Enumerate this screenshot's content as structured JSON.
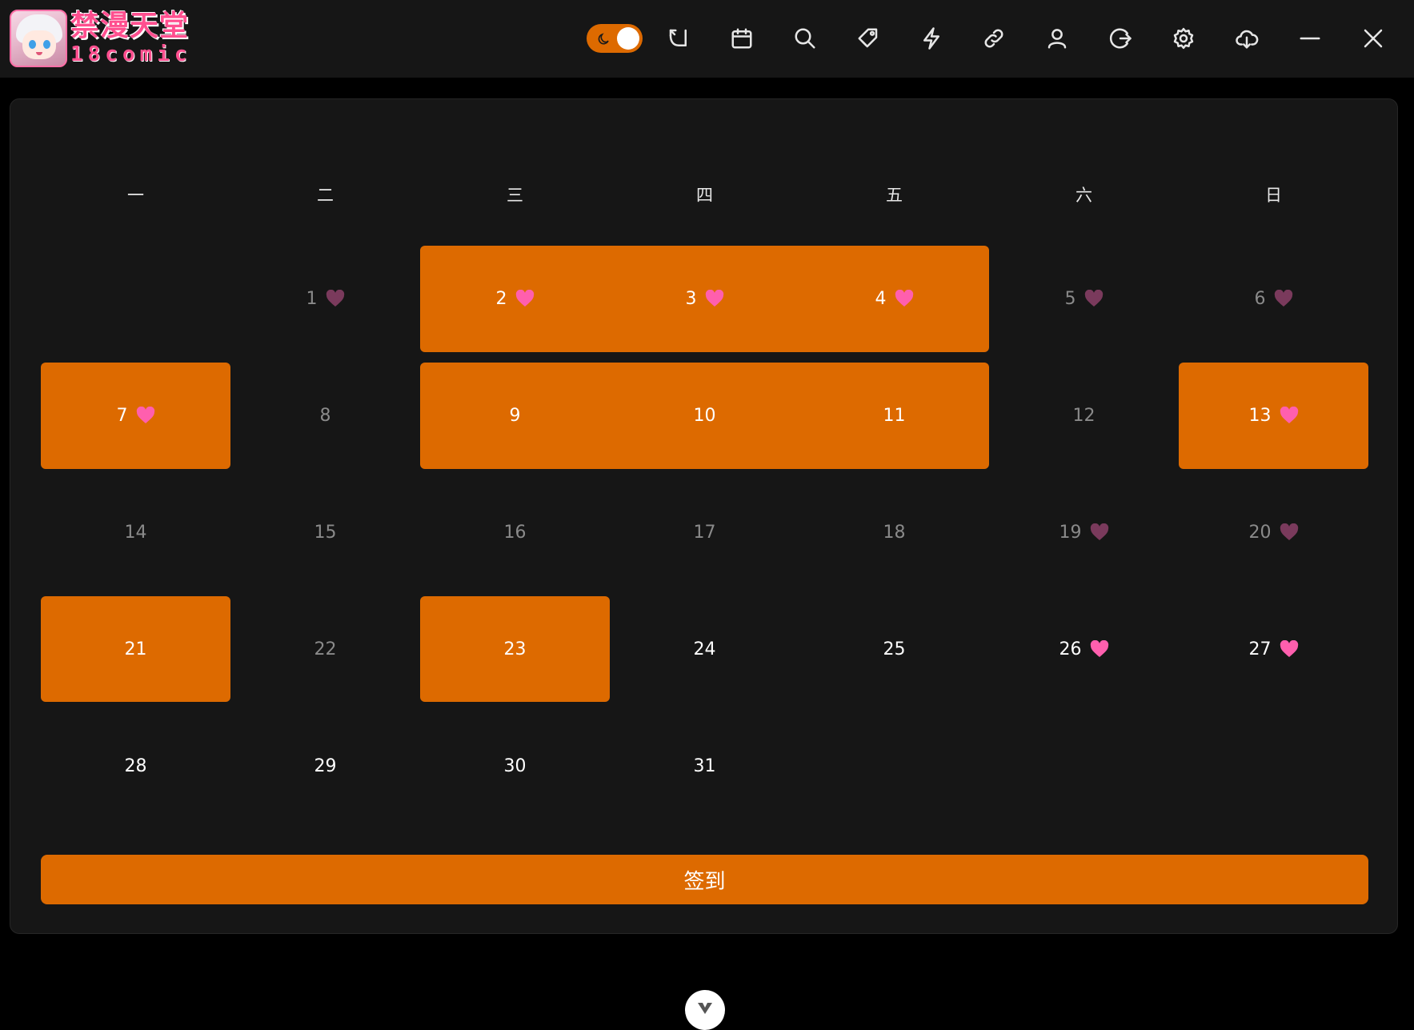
{
  "app": {
    "logo_cn": "禁漫天堂",
    "logo_en": "18comic"
  },
  "toolbar": {
    "icons": [
      "moon-icon",
      "back-icon",
      "calendar-icon",
      "search-icon",
      "tag-icon",
      "lightning-icon",
      "link-icon",
      "user-icon",
      "logout-icon",
      "gear-icon",
      "cloud-download-icon",
      "minimize-icon",
      "close-icon"
    ],
    "dark_mode": true
  },
  "calendar": {
    "weekdays": [
      "一",
      "二",
      "三",
      "四",
      "五",
      "六",
      "日"
    ],
    "days": [
      {
        "day": "1"
      },
      {
        "day": "2"
      },
      {
        "day": "3"
      },
      {
        "day": "4"
      },
      {
        "day": "5"
      },
      {
        "day": "6"
      },
      {
        "day": "7"
      },
      {
        "day": "8"
      },
      {
        "day": "9"
      },
      {
        "day": "10"
      },
      {
        "day": "11"
      },
      {
        "day": "12"
      },
      {
        "day": "13"
      },
      {
        "day": "14"
      },
      {
        "day": "15"
      },
      {
        "day": "16"
      },
      {
        "day": "17"
      },
      {
        "day": "18"
      },
      {
        "day": "19"
      },
      {
        "day": "20"
      },
      {
        "day": "21"
      },
      {
        "day": "22"
      },
      {
        "day": "23"
      },
      {
        "day": "24"
      },
      {
        "day": "25"
      },
      {
        "day": "26"
      },
      {
        "day": "27"
      },
      {
        "day": "28"
      },
      {
        "day": "29"
      },
      {
        "day": "30"
      },
      {
        "day": "31"
      }
    ],
    "signed_days": [
      2,
      3,
      4,
      7,
      9,
      10,
      11,
      13,
      21,
      23
    ],
    "heart_days": [
      1,
      2,
      3,
      4,
      5,
      6,
      7,
      13,
      19,
      20,
      26,
      27
    ]
  },
  "actions": {
    "checkin_label": "签到"
  },
  "colors": {
    "accent": "#dd6a00",
    "heart_bright": "#ff5fae",
    "heart_dim": "#7a3a5c",
    "panel": "#161616",
    "topbar": "#161616"
  }
}
